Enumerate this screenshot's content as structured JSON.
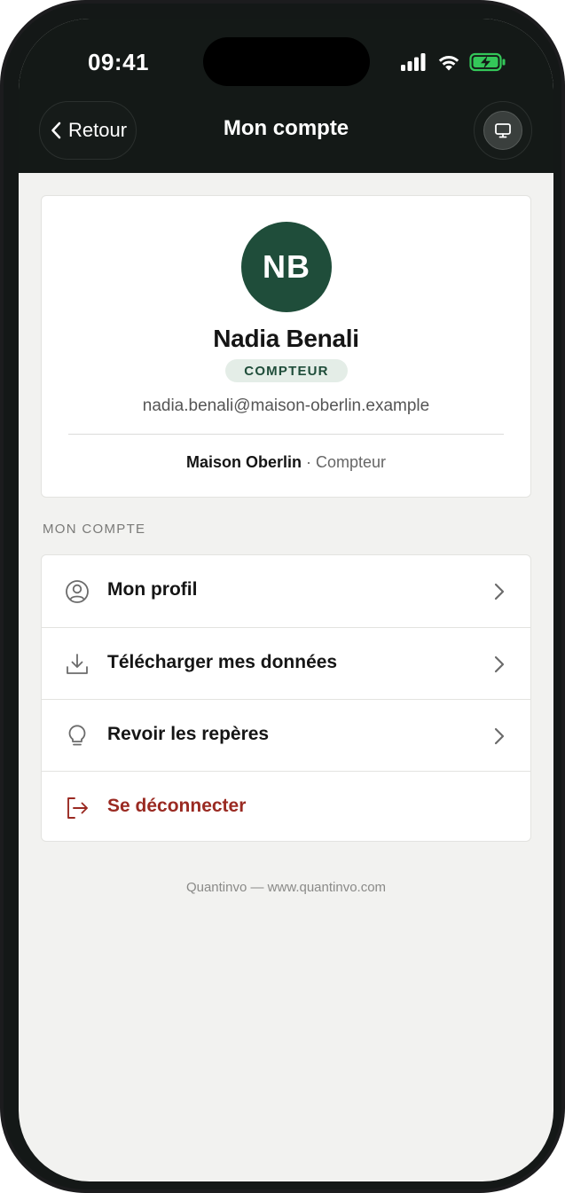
{
  "status_bar": {
    "time": "09:41"
  },
  "header": {
    "back_label": "Retour",
    "title": "Mon compte"
  },
  "profile": {
    "initials": "NB",
    "name": "Nadia Benali",
    "role_badge": "COMPTEUR",
    "email": "nadia.benali@maison-oberlin.example",
    "organization": "Maison Oberlin",
    "separator": " · ",
    "role": "Compteur"
  },
  "section": {
    "label": "MON COMPTE"
  },
  "menu": {
    "items": [
      {
        "label": "Mon profil",
        "icon": "user-circle-icon"
      },
      {
        "label": "Télécharger mes données",
        "icon": "download-icon"
      },
      {
        "label": "Revoir les repères",
        "icon": "lightbulb-icon"
      },
      {
        "label": "Se déconnecter",
        "icon": "logout-icon"
      }
    ]
  },
  "footer": {
    "text": "Quantinvo — www.quantinvo.com"
  },
  "colors": {
    "header_bg": "#141917",
    "brand_green": "#1f4d3a",
    "badge_bg": "#e4ede7",
    "danger": "#9a2a22",
    "battery_green": "#34c759"
  }
}
